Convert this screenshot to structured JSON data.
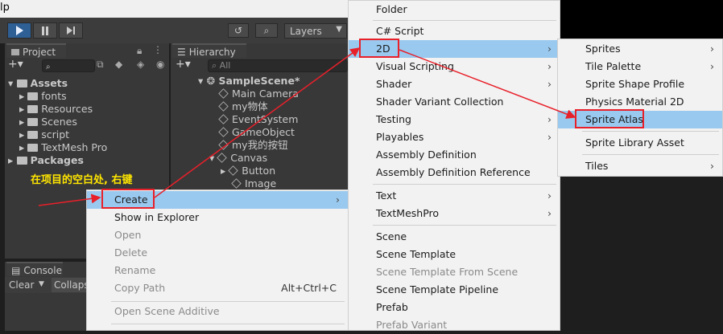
{
  "app": {
    "title_fragment": "lp"
  },
  "toolbar": {
    "layers": "Layers"
  },
  "project": {
    "tab": "Project",
    "tree": [
      {
        "label": "Assets",
        "depth": 0,
        "expanded": true
      },
      {
        "label": "fonts",
        "depth": 1
      },
      {
        "label": "Resources",
        "depth": 1
      },
      {
        "label": "Scenes",
        "depth": 1
      },
      {
        "label": "script",
        "depth": 1
      },
      {
        "label": "TextMesh Pro",
        "depth": 1
      },
      {
        "label": "Packages",
        "depth": 0
      }
    ]
  },
  "hierarchy": {
    "tab": "Hierarchy",
    "search_placeholder": "All",
    "items": [
      {
        "label": "SampleScene*",
        "depth": 0
      },
      {
        "label": "Main Camera",
        "depth": 1
      },
      {
        "label": "my物体",
        "depth": 1
      },
      {
        "label": "EventSystem",
        "depth": 1
      },
      {
        "label": "GameObject",
        "depth": 1
      },
      {
        "label": "my我的按钮",
        "depth": 1
      },
      {
        "label": "Canvas",
        "depth": 1
      },
      {
        "label": "Button",
        "depth": 2
      },
      {
        "label": "Image",
        "depth": 2
      }
    ]
  },
  "console": {
    "tab": "Console",
    "clear": "Clear",
    "collapse": "Collaps"
  },
  "annotation": {
    "text": "在项目的空白处, 右键"
  },
  "context_menu": {
    "items": [
      {
        "label": "Create",
        "has_submenu": true,
        "highlighted": true
      },
      {
        "label": "Show in Explorer"
      },
      {
        "label": "Open",
        "disabled": true
      },
      {
        "label": "Delete",
        "disabled": true
      },
      {
        "label": "Rename",
        "disabled": true
      },
      {
        "label": "Copy Path",
        "disabled": true,
        "shortcut": "Alt+Ctrl+C"
      },
      {
        "label": "Open Scene Additive",
        "disabled": true
      }
    ]
  },
  "create_menu": {
    "items": [
      {
        "label": "Folder"
      },
      {
        "label": "C# Script"
      },
      {
        "label": "2D",
        "has_submenu": true,
        "highlighted": true
      },
      {
        "label": "Visual Scripting",
        "has_submenu": true
      },
      {
        "label": "Shader",
        "has_submenu": true
      },
      {
        "label": "Shader Variant Collection"
      },
      {
        "label": "Testing",
        "has_submenu": true
      },
      {
        "label": "Playables",
        "has_submenu": true
      },
      {
        "label": "Assembly Definition"
      },
      {
        "label": "Assembly Definition Reference"
      },
      {
        "label": "Text",
        "has_submenu": true
      },
      {
        "label": "TextMeshPro",
        "has_submenu": true
      },
      {
        "label": "Scene"
      },
      {
        "label": "Scene Template"
      },
      {
        "label": "Scene Template From Scene",
        "disabled": true
      },
      {
        "label": "Scene Template Pipeline"
      },
      {
        "label": "Prefab"
      },
      {
        "label": "Prefab Variant",
        "disabled": true
      }
    ]
  },
  "twod_menu": {
    "items": [
      {
        "label": "Sprites",
        "has_submenu": true
      },
      {
        "label": "Tile Palette",
        "has_submenu": true
      },
      {
        "label": "Sprite Shape Profile"
      },
      {
        "label": "Physics Material 2D"
      },
      {
        "label": "Sprite Atlas",
        "highlighted": true
      },
      {
        "label": "Sprite Library Asset"
      },
      {
        "label": "Tiles",
        "has_submenu": true
      }
    ]
  },
  "colors": {
    "highlight": "#99c9ef",
    "annotation_red": "#e8202a",
    "annotation_text": "#ffe600"
  }
}
